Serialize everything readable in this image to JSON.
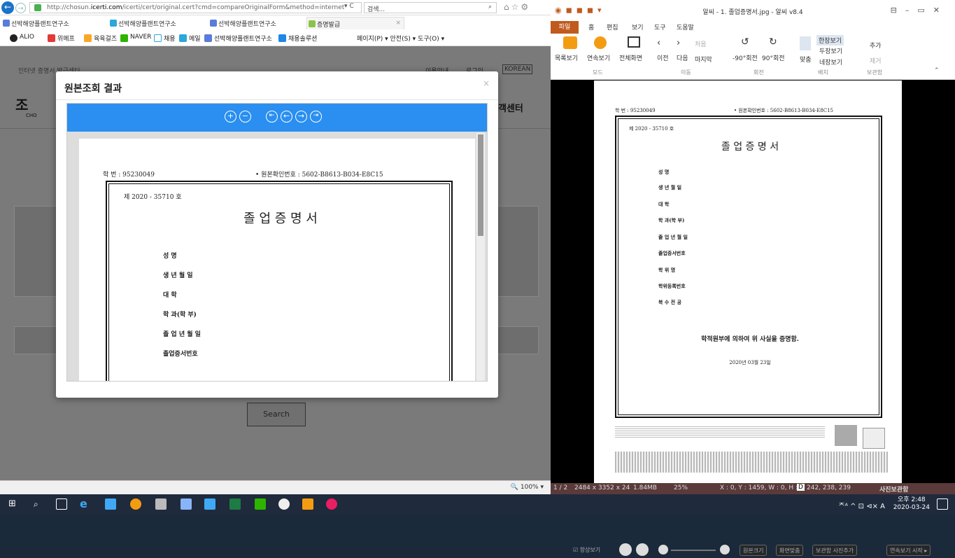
{
  "ie": {
    "url_prefix": "http://chosun.",
    "url_domain": "icerti.com",
    "url_rest": "/icerti/cert/original.cert?cmd=compareOriginalForm&method=internet",
    "url_controls": "▾ C",
    "search_placeholder": "검색...",
    "tabs": [
      "선박해양플랜트연구소",
      "선박해양플랜트연구소",
      "선박해양플랜트연구소",
      "증명발급"
    ],
    "links": [
      "ALIO",
      "위메프",
      "육육걸즈",
      "NAVER",
      "채용",
      "메일",
      "선박해양플랜트연구소",
      "채용솔루션"
    ],
    "command_bar": "페이지(P) ▾  안전(S) ▾  도구(O) ▾",
    "site_header_left": "인터넷 증명서 발급센터",
    "site_header_right_1": "이용안내",
    "site_header_right_2": "로그인",
    "site_header_lang": "KOREAN",
    "site_logo_text": "조",
    "site_logo_sub": "CHO",
    "site_service": "객센터",
    "search_button": "Search",
    "zoom": "100%"
  },
  "modal": {
    "title": "원본조회 결과",
    "close": "×",
    "doc": {
      "student_no_label": "학   번 : 95230049",
      "origin_code": "• 원본확인번호 : 5602-B8613-B034-E8C15",
      "number": "제 2020 - 35710 호",
      "title": "졸   업   증   명   서",
      "fields": [
        "성        명",
        "생 년  월 일",
        "대        학",
        "학 과(학 부)",
        "졸 업 년 월 일",
        "졸업증서번호"
      ]
    }
  },
  "alsee": {
    "window_title": "알씨 - 1. 졸업증명서.jpg - 알씨 v8.4",
    "file_tab": "파일",
    "ribbon_tabs": [
      "홈",
      "편집",
      "보기",
      "도구",
      "도움말"
    ],
    "buttons": {
      "list_view": "목록보기",
      "continuous": "연속보기",
      "fullscreen": "전체화면",
      "prev": "이전",
      "next": "다음",
      "last": "마지막",
      "first": "처음",
      "rot_left": "-90°회전",
      "rot_right": "90°회전",
      "fit": "맞춤",
      "one_page": "한장보기",
      "two_page": "두장보기",
      "four_page": "네장보기",
      "add": "추가",
      "remove": "제거"
    },
    "groups": [
      "모드",
      "이동",
      "회전",
      "배치",
      "보관함"
    ],
    "doc": {
      "student_no_label": "학   번 : 95230049",
      "origin_code": "• 원본확인번호 : 5602-B8613-B034-E8C15",
      "number": "제 2020 - 35710 호",
      "title": "졸   업   증   명   서",
      "fields": [
        "성        명",
        "생 년  월 일",
        "대        학",
        "학 과(학 부)",
        "졸 업 년 월 일",
        "졸업증서번호",
        "학   위   명",
        "학위등록번호",
        "복  수  전  공"
      ],
      "statement": "학적원부에 의하여 위 사실을 증명함.",
      "date": "2020년  03월 23일"
    },
    "bottom": {
      "always_on_top": "항상보기",
      "original_size": "원본크기",
      "fit_screen": "화면맞춤",
      "add_to_box": "보관함 사진추가",
      "slideshow": "연속보기 시작 ▸"
    },
    "status": {
      "page": "1 / 2",
      "dims": "2484 x 3352 x 24",
      "size": "1.84MB",
      "zoom": "25%",
      "coords": "X : 0, Y : 1459, W : 0, H : 0",
      "color": "242, 238, 239",
      "photo_box": "사진보관함"
    }
  },
  "taskbar": {
    "time": "오후 2:48",
    "date": "2020-03-24",
    "tray": "ᄌᴬ  ^  ⊡  ⊲×  A"
  },
  "colors": {
    "viewer_toolbar": "#2a8ff0",
    "alsee_file_tab": "#c05a1e",
    "taskbar": "#1f2a3c"
  }
}
